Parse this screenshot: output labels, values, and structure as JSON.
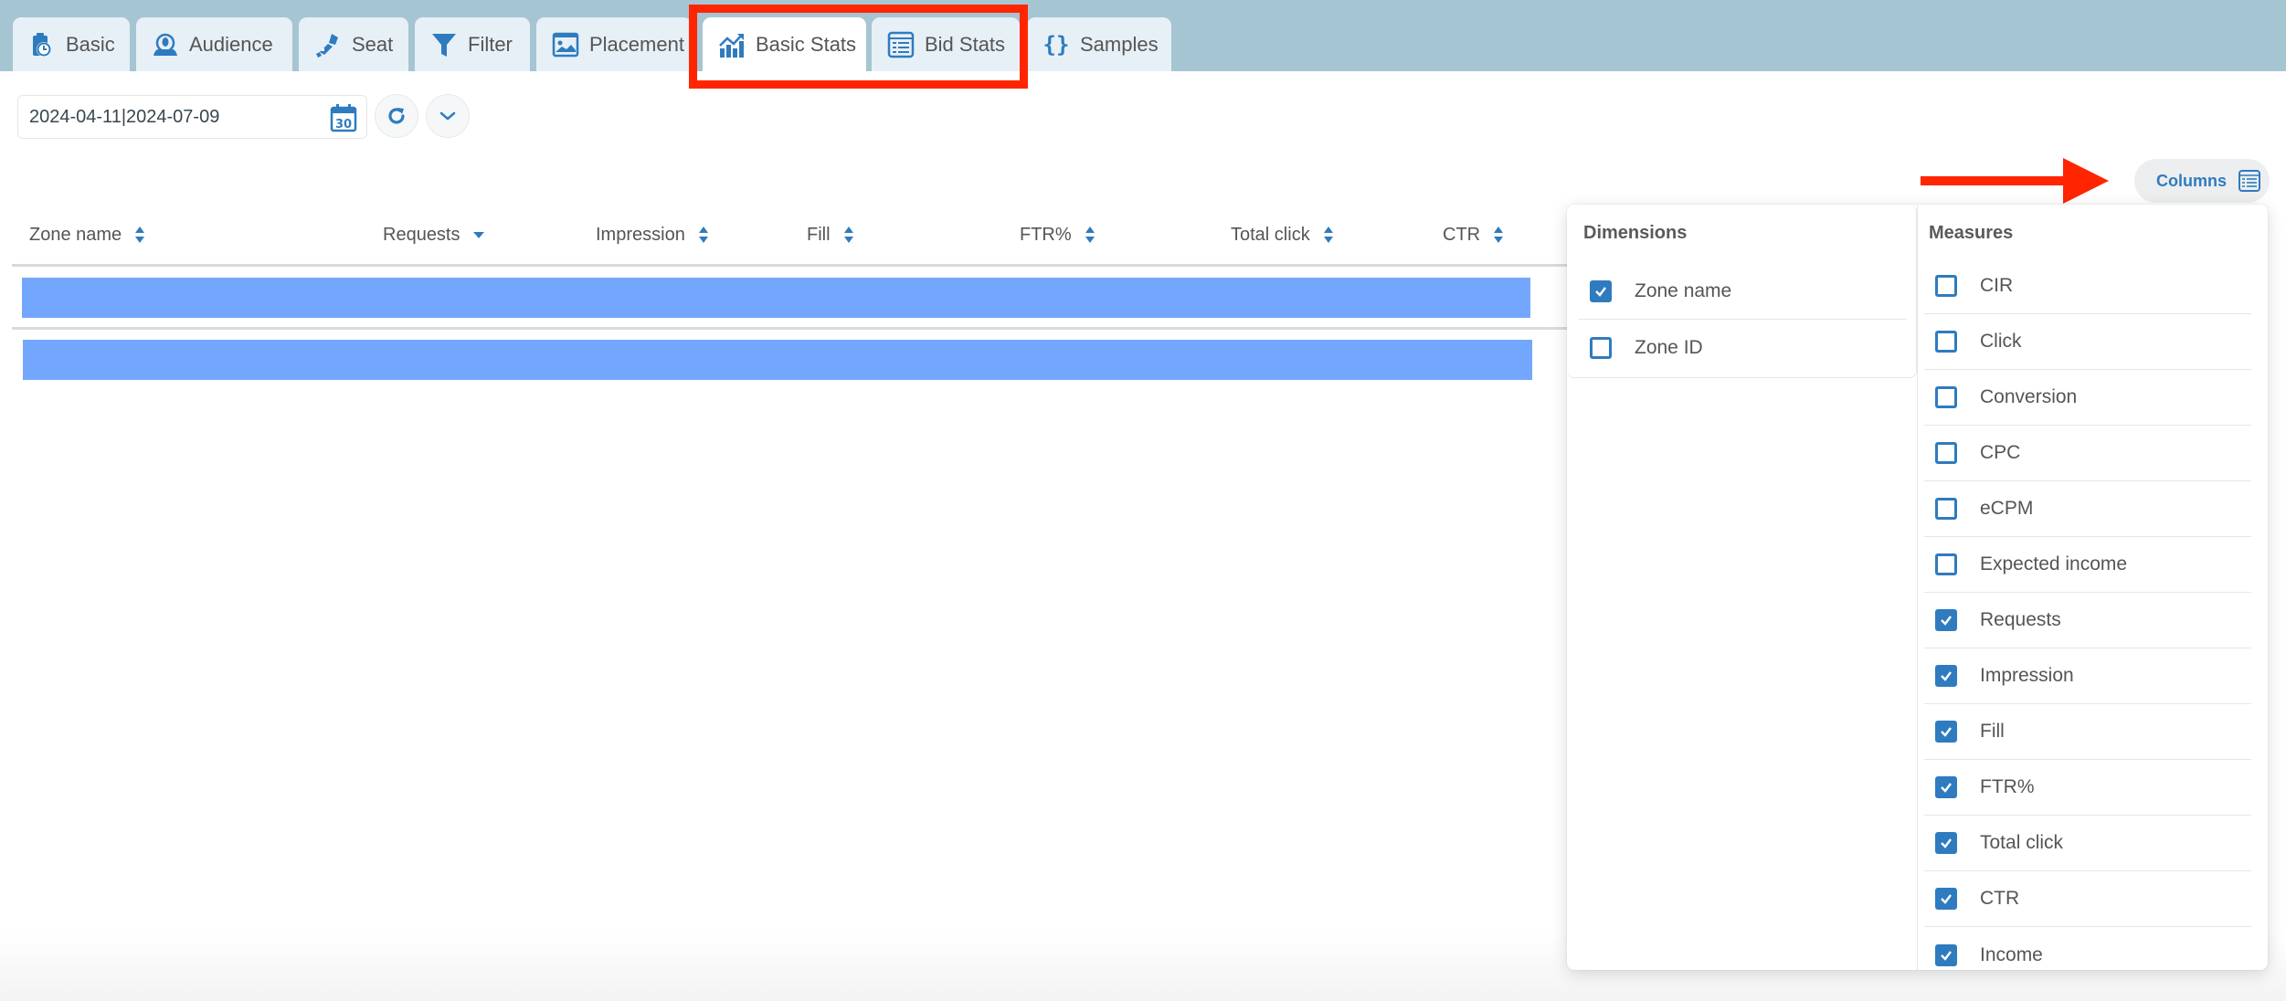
{
  "tabs": [
    {
      "label": "Basic",
      "icon": "stopwatch-clipboard-icon",
      "active": false
    },
    {
      "label": "Audience",
      "icon": "audience-icon",
      "active": false
    },
    {
      "label": "Seat",
      "icon": "seat-belt-icon",
      "active": false
    },
    {
      "label": "Filter",
      "icon": "funnel-icon",
      "active": false
    },
    {
      "label": "Placement",
      "icon": "placement-image-icon",
      "active": false
    },
    {
      "label": "Basic Stats",
      "icon": "chart-up-icon",
      "active": true
    },
    {
      "label": "Bid Stats",
      "icon": "list-table-icon",
      "active": false
    },
    {
      "label": "Samples",
      "icon": "braces-icon",
      "active": false
    }
  ],
  "toolbar": {
    "date_range": "2024-04-11|2024-07-09",
    "calendar_icon_day": "30",
    "refresh_icon": "refresh-icon",
    "expand_icon": "chevron-down-icon"
  },
  "columns_button": {
    "label": "Columns",
    "icon": "columns-list-icon"
  },
  "table": {
    "headers": [
      {
        "label": "Zone name",
        "sort": "both"
      },
      {
        "label": "Requests",
        "sort": "desc"
      },
      {
        "label": "Impression",
        "sort": "both"
      },
      {
        "label": "Fill",
        "sort": "both"
      },
      {
        "label": "FTR%",
        "sort": "both"
      },
      {
        "label": "Total click",
        "sort": "both"
      },
      {
        "label": "CTR",
        "sort": "both"
      }
    ],
    "rows": [
      {
        "state": "highlighted"
      },
      {
        "state": "highlighted"
      }
    ]
  },
  "columns_menu": {
    "dimensions": {
      "title": "Dimensions",
      "items": [
        {
          "label": "Zone name",
          "checked": true
        },
        {
          "label": "Zone ID",
          "checked": false
        }
      ]
    },
    "measures": {
      "title": "Measures",
      "items": [
        {
          "label": "CIR",
          "checked": false
        },
        {
          "label": "Click",
          "checked": false
        },
        {
          "label": "Conversion",
          "checked": false
        },
        {
          "label": "CPC",
          "checked": false
        },
        {
          "label": "eCPM",
          "checked": false
        },
        {
          "label": "Expected income",
          "checked": false
        },
        {
          "label": "Requests",
          "checked": true
        },
        {
          "label": "Impression",
          "checked": true
        },
        {
          "label": "Fill",
          "checked": true
        },
        {
          "label": "FTR%",
          "checked": true
        },
        {
          "label": "Total click",
          "checked": true
        },
        {
          "label": "CTR",
          "checked": true
        },
        {
          "label": "Income",
          "checked": true
        }
      ]
    }
  },
  "annotations": {
    "highlight_color": "#ff2500",
    "highlight_targets": [
      "Basic Stats",
      "Bid Stats"
    ],
    "arrow_target": "Columns"
  },
  "colors": {
    "topbar": "#a6c5d3",
    "tab_bg": "#e7f0f6",
    "accent": "#2f7bbf",
    "row_highlight": "#73a7fd"
  }
}
